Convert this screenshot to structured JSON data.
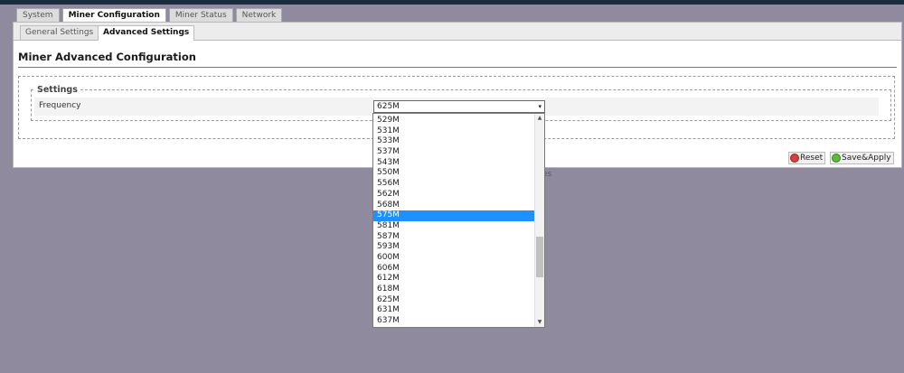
{
  "main_tabs": [
    {
      "label": "System",
      "active": false
    },
    {
      "label": "Miner Configuration",
      "active": true
    },
    {
      "label": "Miner Status",
      "active": false
    },
    {
      "label": "Network",
      "active": false
    }
  ],
  "sub_tabs": [
    {
      "label": "General Settings",
      "active": false
    },
    {
      "label": "Advanced Settings",
      "active": true
    }
  ],
  "page": {
    "title": "Miner Advanced Configuration",
    "settings_legend": "Settings",
    "frequency_label": "Frequency",
    "frequency_value": "625M"
  },
  "dropdown": {
    "options": [
      "529M",
      "531M",
      "533M",
      "537M",
      "543M",
      "550M",
      "556M",
      "562M",
      "568M",
      "575M",
      "581M",
      "587M",
      "593M",
      "600M",
      "606M",
      "612M",
      "618M",
      "625M",
      "631M",
      "637M"
    ],
    "highlighted": "575M",
    "icons": {
      "arrow": "▾",
      "scroll_up": "▲",
      "scroll_down": "▼"
    }
  },
  "buttons": {
    "reset": "Reset",
    "save_apply": "Save&Apply"
  },
  "behind_text": "es"
}
